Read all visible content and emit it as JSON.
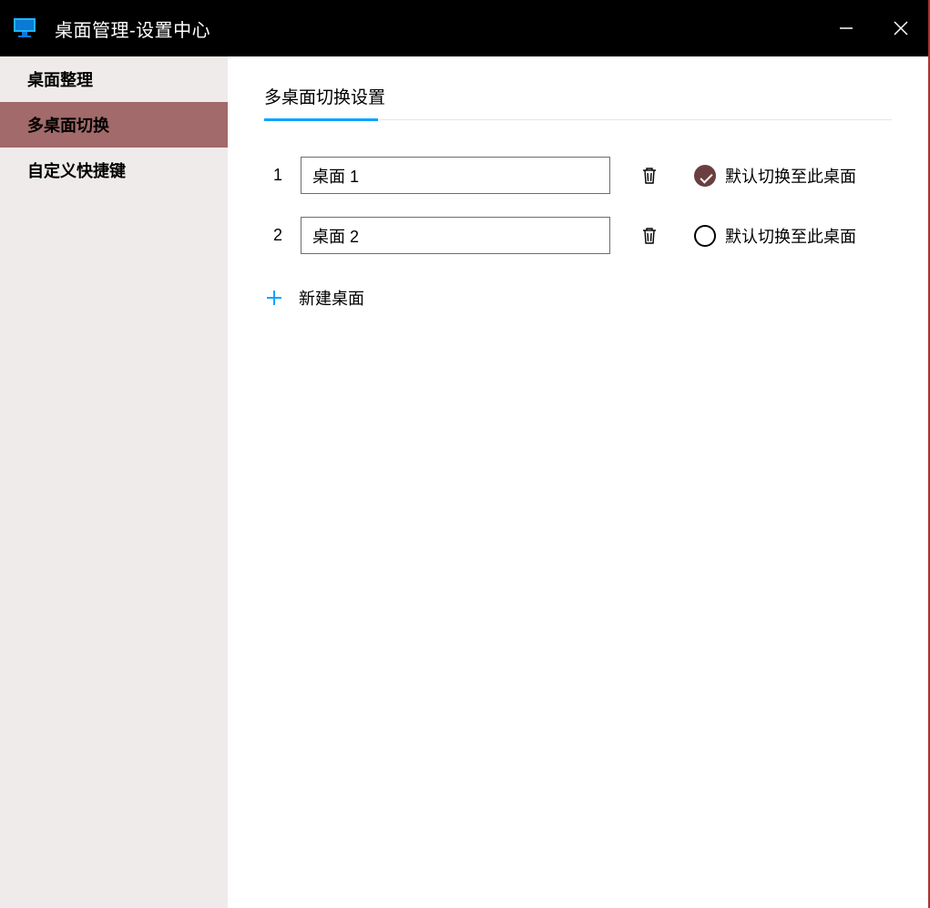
{
  "window": {
    "title": "桌面管理-设置中心"
  },
  "sidebar": {
    "items": [
      {
        "label": "桌面整理",
        "active": false
      },
      {
        "label": "多桌面切换",
        "active": true
      },
      {
        "label": "自定义快捷键",
        "active": false
      }
    ]
  },
  "main": {
    "section_title": "多桌面切换设置",
    "default_label": "默认切换至此桌面",
    "desktops": [
      {
        "index": "1",
        "name": "桌面 1",
        "is_default": true
      },
      {
        "index": "2",
        "name": "桌面 2",
        "is_default": false
      }
    ],
    "add_label": "新建桌面"
  }
}
